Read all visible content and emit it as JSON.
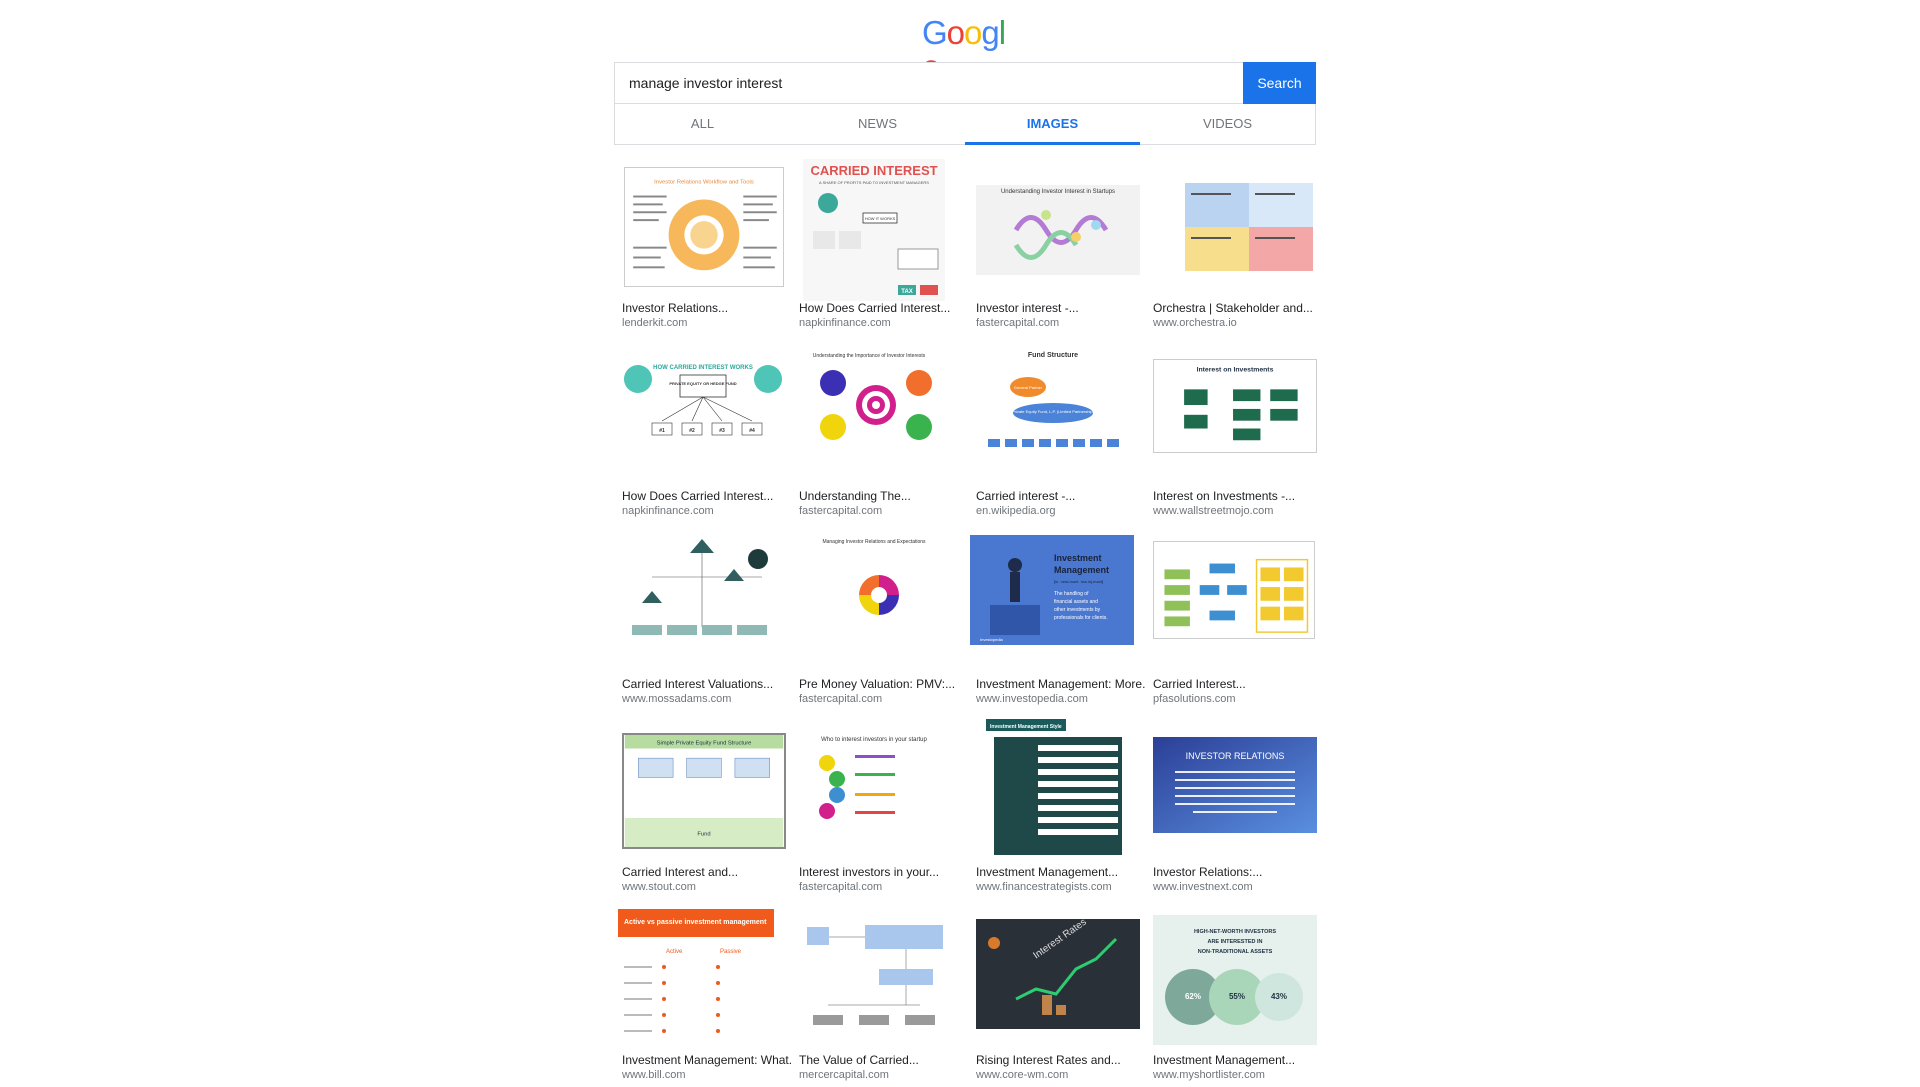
{
  "logo": {
    "text": "Google",
    "colors": [
      "#4285f4",
      "#ea4335",
      "#fbbc05",
      "#4285f4",
      "#34a853",
      "#ea4335"
    ]
  },
  "search": {
    "query": "manage investor interest",
    "button_label": "Search"
  },
  "tabs": [
    {
      "label": "ALL",
      "active": false
    },
    {
      "label": "NEWS",
      "active": false
    },
    {
      "label": "IMAGES",
      "active": true
    },
    {
      "label": "VIDEOS",
      "active": false
    }
  ],
  "results": [
    {
      "caption": "Investor Relations...",
      "source": "lenderkit.com"
    },
    {
      "caption": "How Does Carried Interest...",
      "source": "napkinfinance.com"
    },
    {
      "caption": "Investor interest -...",
      "source": "fastercapital.com"
    },
    {
      "caption": "Orchestra | Stakeholder and...",
      "source": "www.orchestra.io"
    },
    {
      "caption": "How Does Carried Interest...",
      "source": "napkinfinance.com"
    },
    {
      "caption": "Understanding The...",
      "source": "fastercapital.com"
    },
    {
      "caption": "Carried interest -...",
      "source": "en.wikipedia.org"
    },
    {
      "caption": "Interest on Investments -...",
      "source": "www.wallstreetmojo.com"
    },
    {
      "caption": "Carried Interest Valuations...",
      "source": "www.mossadams.com"
    },
    {
      "caption": "Pre Money Valuation: PMV:...",
      "source": "fastercapital.com"
    },
    {
      "caption": "Investment Management: More...",
      "source": "www.investopedia.com"
    },
    {
      "caption": "Carried Interest...",
      "source": "pfasolutions.com"
    },
    {
      "caption": "Carried Interest and...",
      "source": "www.stout.com"
    },
    {
      "caption": "Interest investors in your...",
      "source": "fastercapital.com"
    },
    {
      "caption": "Investment Management...",
      "source": "www.financestrategists.com"
    },
    {
      "caption": "Investor Relations:...",
      "source": "www.investnext.com"
    },
    {
      "caption": "Investment Management: What...",
      "source": "www.bill.com"
    },
    {
      "caption": "The Value of Carried...",
      "source": "mercercapital.com"
    },
    {
      "caption": "Rising Interest Rates and...",
      "source": "www.core-wm.com"
    },
    {
      "caption": "Investment Management...",
      "source": "www.myshortlister.com"
    }
  ],
  "thumbs": {
    "t0": {
      "title": "Investor Relations Workflow and Tools"
    },
    "t1": {
      "title": "CARRIED INTEREST",
      "subtitle": "A SHARE OF PROFITS PAID TO INVESTMENT MANAGERS",
      "howitworks": "HOW IT WORKS",
      "tax": "TAX"
    },
    "t2": {
      "title": "Understanding Investor Interest in Startups"
    },
    "t4": {
      "title": "HOW CARRIED INTEREST WORKS",
      "center": "PRIVATE EQUITY OR HEDGE FUND",
      "n1": "#1",
      "n2": "#2",
      "n3": "#3",
      "n4": "#4"
    },
    "t5": {
      "title": "Understanding the Importance of Investor Interests"
    },
    "t6": {
      "title": "Fund Structure",
      "gp": "General Partner",
      "fund": "Private Equity Fund, L.P. (Limited Partnership)"
    },
    "t7": {
      "title": "Interest on Investments"
    },
    "t9": {
      "title": "Managing Investor Relations and Expectations"
    },
    "t10": {
      "title": "Investment Management",
      "pron": "[in-ˈvest-mənt ˈma-nij-mənt]",
      "body": "The handling of financial assets and other investments by professionals for clients.",
      "brand": "Investopedia"
    },
    "t12": {
      "title": "Simple Private Equity Fund Structure",
      "fund": "Fund"
    },
    "t13": {
      "title": "Who to interest investors in your startup"
    },
    "t14": {
      "title": "Investment Management Style"
    },
    "t15": {
      "title": "INVESTOR RELATIONS"
    },
    "t16": {
      "title": "Active vs passive investment management",
      "active": "Active",
      "passive": "Passive"
    },
    "t18": {
      "title": "Interest Rates"
    },
    "t19": {
      "title": "HIGH-NET-WORTH INVESTORS ARE INTERESTED IN NON-TRADITIONAL ASSETS",
      "p1": "62%",
      "p2": "55%",
      "p3": "43%"
    }
  },
  "colors": {
    "accent": "#1a73e8",
    "tab_text": "#70757a",
    "source_text": "#70757a",
    "border": "#dadce0"
  }
}
